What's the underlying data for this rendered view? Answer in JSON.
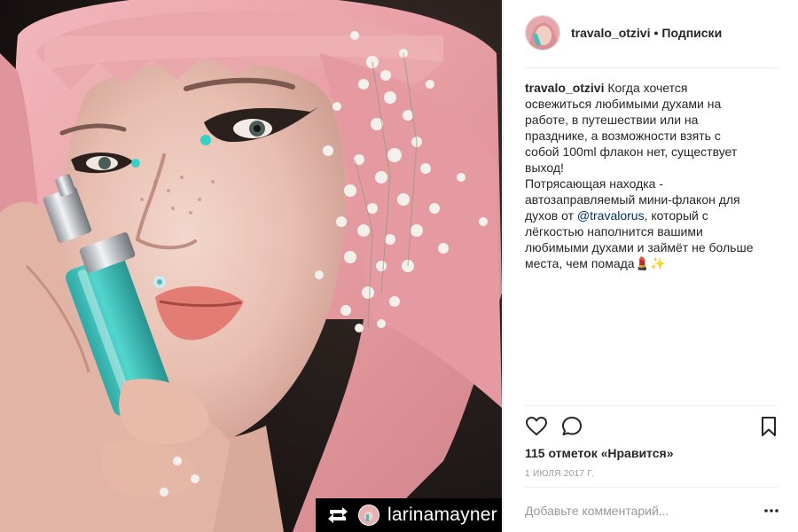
{
  "post": {
    "author": "travalo_otzivi",
    "separator": "•",
    "follow_label": "Подписки",
    "caption_user": "travalo_otzivi",
    "caption_part1": "Когда хочется освежиться любимыми духами на работе, в путешествии или на празднике, а возможности взять с собой 100ml флакон нет, существует выход!",
    "caption_part2_before": "Потрясающая находка - автозаправляемый мини-флакон для духов от ",
    "caption_mention": "@travalorus",
    "caption_part2_after": ", который с лёгкостью наполнится вашими любимыми духами и займёт не больше места, чем помада",
    "caption_emoji": "💄✨",
    "likes_text": "115 отметок «Нравится»",
    "date_text": "1 июля 2017 г.",
    "comment_placeholder": "Добавьте комментарий...",
    "repost_username": "larinamayner"
  },
  "icons": {
    "like": "heart-icon",
    "comment": "speech-bubble-icon",
    "save": "bookmark-icon",
    "more": "more-dots-icon",
    "repost": "repost-icon"
  },
  "colors": {
    "text": "#262626",
    "muted": "#999999",
    "mention": "#003569",
    "divider": "#efefef",
    "hair": "#e8a3a8",
    "bottle": "#3cc3bc"
  }
}
